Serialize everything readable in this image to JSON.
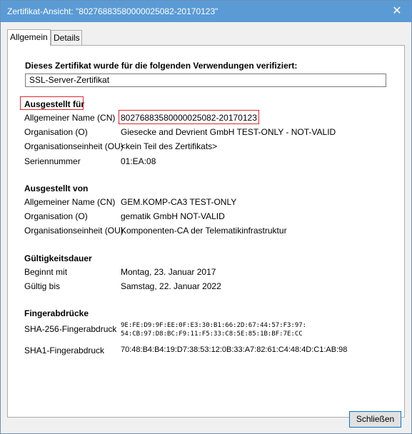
{
  "window": {
    "title": "Zertifikat-Ansicht: \"80276883580000025082-20170123\"",
    "close_glyph": "✕"
  },
  "tabs": [
    {
      "label": "Allgemein",
      "active": true
    },
    {
      "label": "Details",
      "active": false
    }
  ],
  "usage": {
    "heading": "Dieses Zertifikat wurde für die folgenden Verwendungen verifiziert:",
    "value": "SSL-Server-Zertifikat"
  },
  "issued_to": {
    "heading": "Ausgestellt für",
    "rows": [
      {
        "label": "Allgemeiner Name (CN)",
        "value": "80276883580000025082-20170123"
      },
      {
        "label": "Organisation (O)",
        "value": "Giesecke and Devrient GmbH TEST-ONLY - NOT-VALID"
      },
      {
        "label": "Organisationseinheit (OU)",
        "value": "<kein Teil des Zertifikats>"
      },
      {
        "label": "Seriennummer",
        "value": "01:EA:08"
      }
    ]
  },
  "issued_by": {
    "heading": "Ausgestellt von",
    "rows": [
      {
        "label": "Allgemeiner Name (CN)",
        "value": "GEM.KOMP-CA3 TEST-ONLY"
      },
      {
        "label": "Organisation (O)",
        "value": "gematik GmbH NOT-VALID"
      },
      {
        "label": "Organisationseinheit (OU)",
        "value": "Komponenten-CA der Telematikinfrastruktur"
      }
    ]
  },
  "validity": {
    "heading": "Gültigkeitsdauer",
    "rows": [
      {
        "label": "Beginnt mit",
        "value": "Montag, 23. Januar 2017"
      },
      {
        "label": "Gültig bis",
        "value": "Samstag, 22. Januar 2022"
      }
    ]
  },
  "fingerprints": {
    "heading": "Fingerabdrücke",
    "sha256_label": "SHA-256-Fingerabdruck",
    "sha256_line1": "9E:FE:D9:9F:EE:0F:E3:30:B1:66:2D:67:44:57:F3:97:",
    "sha256_line2": "54:CB:97:D8:BC:F9:11:F5:33:C8:5E:85:1B:BF:7E:CC",
    "sha1_label": "SHA1-Fingerabdruck",
    "sha1_value": "70:48:B4:B4:19:D7:38:53:12:0B:33:A7:82:61:C4:48:4D:C1:AB:98"
  },
  "buttons": {
    "close_label": "Schließen"
  },
  "colors": {
    "titlebar": "#5b9bd5",
    "highlight": "#e0262b",
    "button_border": "#0078d7"
  }
}
